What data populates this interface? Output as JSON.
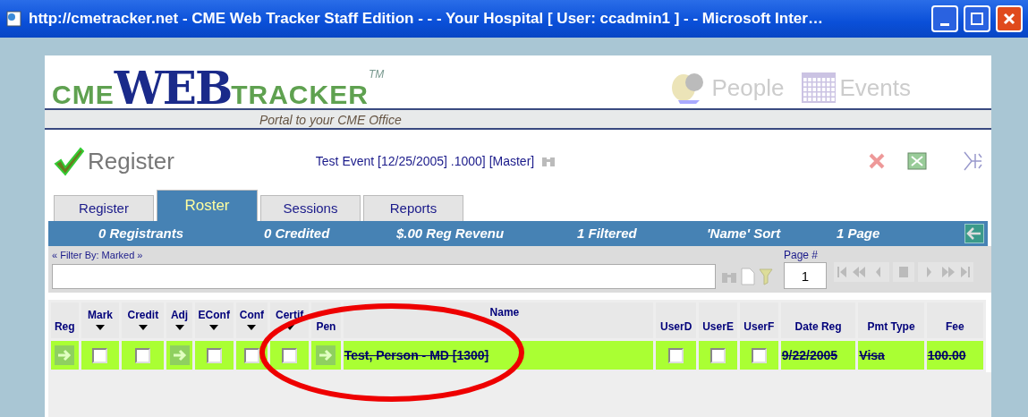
{
  "window": {
    "title": "http://cmetracker.net - CME Web Tracker Staff Edition - - - Your Hospital [ User: ccadmin1 ] -  - Microsoft Inter…"
  },
  "logo": {
    "prefix": "CME",
    "main": "WEB",
    "suffix": "TRACKER",
    "mark": "TM",
    "tagline": "Portal to your CME Office"
  },
  "nav": [
    {
      "label": "People",
      "kind": "people"
    },
    {
      "label": "Events",
      "kind": "events"
    }
  ],
  "page": {
    "heading": "Register",
    "event": "Test Event [12/25/2005] .1000] [Master]"
  },
  "tabs": [
    {
      "label": "Register",
      "selected": false
    },
    {
      "label": "Roster",
      "selected": true
    },
    {
      "label": "Sessions",
      "selected": false
    },
    {
      "label": "Reports",
      "selected": false
    }
  ],
  "stats": [
    "0 Registrants",
    "0 Credited",
    "$.00 Reg Revenu",
    "1 Filtered",
    "'Name' Sort",
    "1 Page"
  ],
  "filter": {
    "label": "« Filter By: Marked »",
    "page_label": "Page #",
    "page_value": "1"
  },
  "table": {
    "columns": [
      {
        "label": "Reg",
        "sortable": false
      },
      {
        "label": "Mark",
        "sortable": true
      },
      {
        "label": "Credit",
        "sortable": true
      },
      {
        "label": "Adj",
        "sortable": true
      },
      {
        "label": "EConf",
        "sortable": true
      },
      {
        "label": "Conf",
        "sortable": true
      },
      {
        "label": "Certif",
        "sortable": true
      },
      {
        "label": "Pen",
        "sortable": false
      },
      {
        "label": "Name",
        "sortable": false
      },
      {
        "label": "UserD",
        "sortable": false
      },
      {
        "label": "UserE",
        "sortable": false
      },
      {
        "label": "UserF",
        "sortable": false
      },
      {
        "label": "Date Reg",
        "sortable": false
      },
      {
        "label": "Pmt Type",
        "sortable": false
      },
      {
        "label": "Fee",
        "sortable": false
      }
    ],
    "rows": [
      {
        "highlighted": true,
        "cancelled": true,
        "cells": [
          {
            "kind": "arrow"
          },
          {
            "kind": "checkbox",
            "checked": false
          },
          {
            "kind": "checkbox",
            "checked": false
          },
          {
            "kind": "arrow"
          },
          {
            "kind": "checkbox",
            "checked": false
          },
          {
            "kind": "checkbox",
            "checked": false
          },
          {
            "kind": "checkbox",
            "checked": false
          },
          {
            "kind": "arrow"
          },
          {
            "kind": "text",
            "text": "Test, Person - MD [1300]"
          },
          {
            "kind": "checkbox",
            "checked": false
          },
          {
            "kind": "checkbox",
            "checked": false
          },
          {
            "kind": "checkbox",
            "checked": false
          },
          {
            "kind": "text",
            "text": "9/22/2005"
          },
          {
            "kind": "text",
            "text": "Visa"
          },
          {
            "kind": "text",
            "text": "100.00"
          }
        ]
      }
    ]
  },
  "annotation": {
    "kind": "ellipse",
    "color": "#ee0000"
  }
}
